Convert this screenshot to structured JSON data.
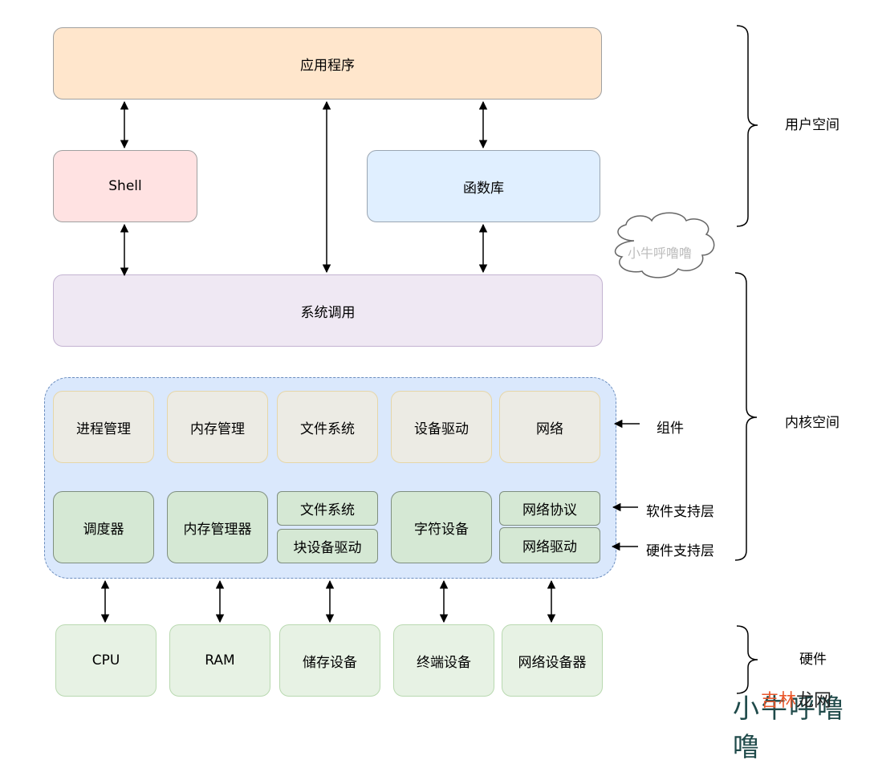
{
  "user_space": {
    "application": "应用程序",
    "shell": "Shell",
    "library": "函数库",
    "system_call": "系统调用"
  },
  "kernel": {
    "components": [
      "进程管理",
      "内存管理",
      "文件系统",
      "设备驱动",
      "网络"
    ],
    "support": {
      "scheduler": "调度器",
      "memory_manager": "内存管理器",
      "filesystem": "文件系统",
      "block_driver": "块设备驱动",
      "char_device": "字符设备",
      "net_protocol": "网络协议",
      "net_driver": "网络驱动"
    }
  },
  "hardware": [
    "CPU",
    "RAM",
    "储存设备",
    "终端设备",
    "网络设备器"
  ],
  "side_labels": {
    "components": "组件",
    "software_support": "软件支持层",
    "hardware_support": "硬件支持层"
  },
  "brace_labels": {
    "user_space": "用户空间",
    "kernel_space": "内核空间",
    "hardware": "硬件"
  },
  "cloud_text": "小牛呼噜噜",
  "watermark": {
    "background": "小牛呼噜噜",
    "red": "吉林",
    "dark": "龙网"
  }
}
